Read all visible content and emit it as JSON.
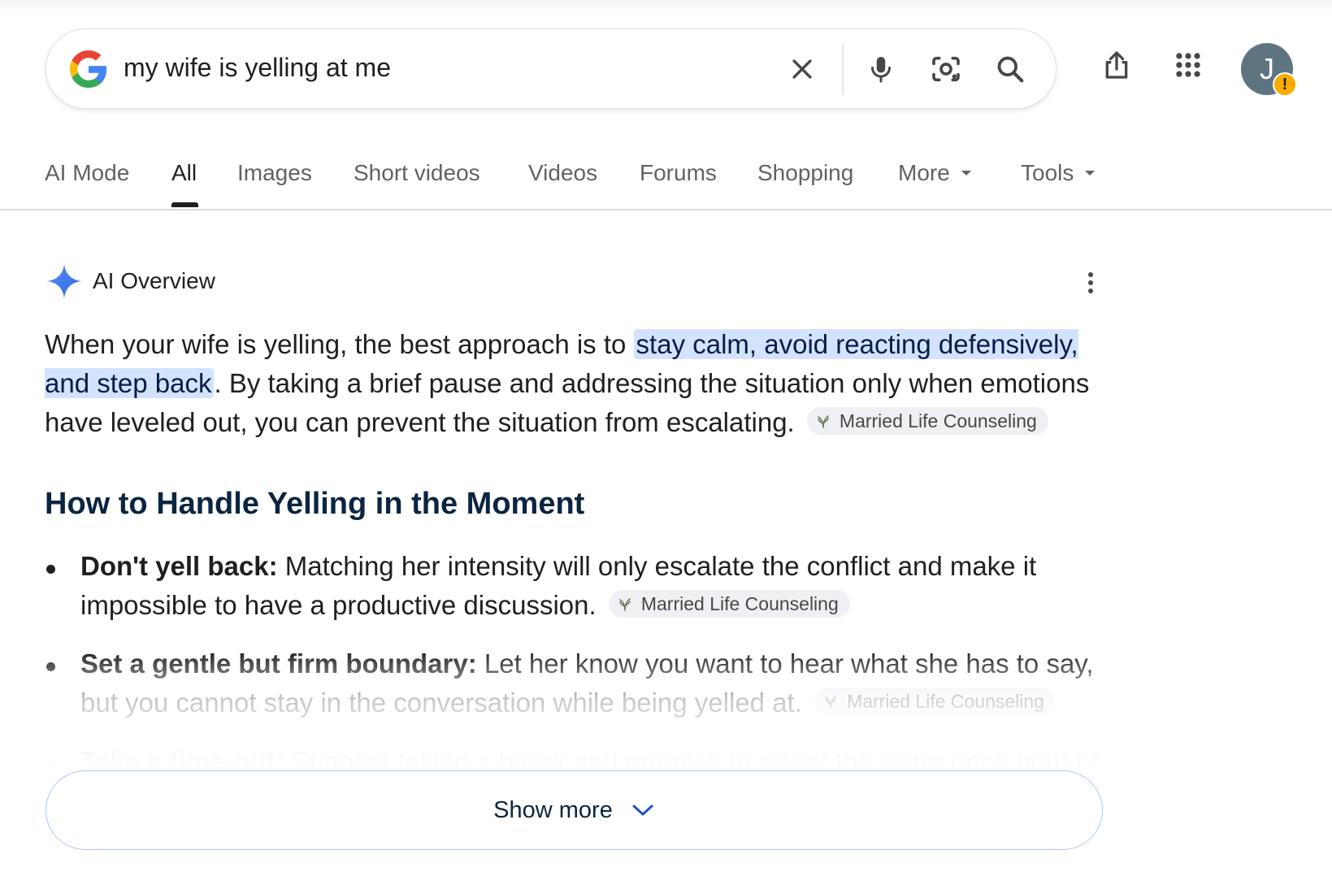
{
  "search": {
    "query": "my wife is yelling at me"
  },
  "avatar": {
    "initial": "J",
    "badge": "!"
  },
  "tabs": [
    {
      "label": "AI Mode"
    },
    {
      "label": "All",
      "active": true
    },
    {
      "label": "Images"
    },
    {
      "label": "Short videos"
    },
    {
      "label": "Videos"
    },
    {
      "label": "Forums"
    },
    {
      "label": "Shopping"
    },
    {
      "label": "More",
      "dropdown": true
    },
    {
      "label": "Tools",
      "dropdown": true
    }
  ],
  "ai_overview": {
    "title": "AI Overview",
    "para_before": "When your wife is yelling, the best approach is to ",
    "para_highlight": "stay calm, avoid reacting defensively, and step back",
    "para_after": ". By taking a brief pause and addressing the situation only when emotions have leveled out, you can prevent the situation from escalating.",
    "source_chip": "Married Life Counseling",
    "subheading": "How to Handle Yelling in the Moment",
    "bullets": [
      {
        "bold": "Don't yell back:",
        "text": " Matching her intensity will only escalate the conflict and make it impossible to have a productive discussion.",
        "source": "Married Life Counseling"
      },
      {
        "bold": "Set a gentle but firm boundary:",
        "text": " Let her know you want to hear what she has to say, but you cannot stay in the conversation while being yelled at.",
        "source": "Married Life Counseling"
      },
      {
        "bold": "Take a time-out:",
        "text": " Suggest taking a break and promise to revisit the issue once both of",
        "source": ""
      }
    ],
    "show_more": "Show more"
  },
  "colors": {
    "highlight_bg": "#d3e3fd",
    "chip_bg": "#eef0f3",
    "accent_blue": "#4285f4",
    "heading_navy": "#0b2540",
    "warn_badge": "#f9ab00"
  }
}
